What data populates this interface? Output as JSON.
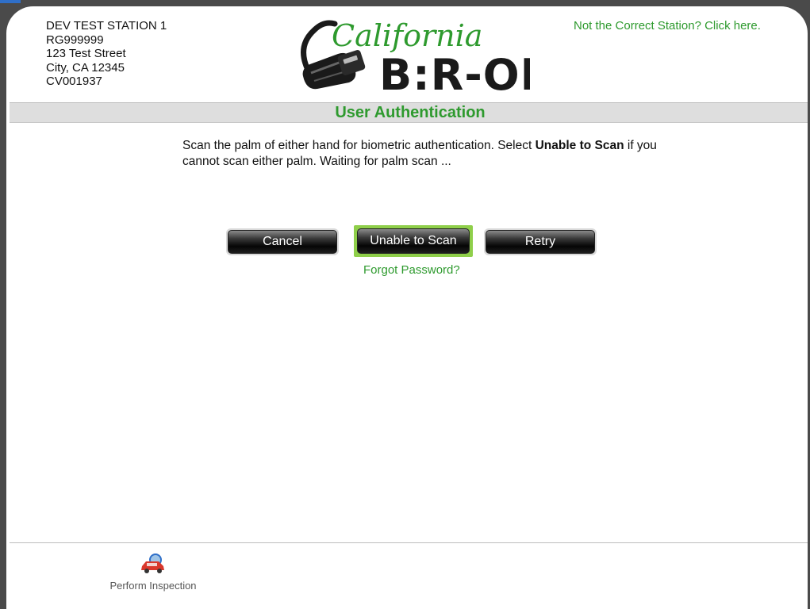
{
  "station": {
    "name": "DEV TEST STATION 1",
    "id": "RG999999",
    "street": "123 Test Street",
    "city": "City, CA 12345",
    "code": "CV001937"
  },
  "logo": {
    "script_text": "California",
    "main_text": "B:R-OIS",
    "colors": {
      "script": "#2e9a2e",
      "main": "#1a1a1a"
    }
  },
  "header": {
    "wrong_station_link": "Not the Correct Station? Click here."
  },
  "page": {
    "title": "User Authentication"
  },
  "instructions": {
    "part1": "Scan the palm of either hand for biometric authentication. Select ",
    "bold": "Unable to Scan",
    "part2": " if you cannot scan either palm. Waiting for palm scan ..."
  },
  "buttons": {
    "cancel": "Cancel",
    "unable_to_scan": "Unable to Scan",
    "retry": "Retry"
  },
  "links": {
    "forgot_password": "Forgot Password?"
  },
  "footer": {
    "perform_inspection_label": "Perform Inspection",
    "perform_inspection_icon": "car-inspection-icon"
  },
  "colors": {
    "accent_green": "#2e9a2e",
    "focus_green": "#8fcf4a",
    "title_bar": "#dedede",
    "window_frame": "#4a4a4a"
  }
}
